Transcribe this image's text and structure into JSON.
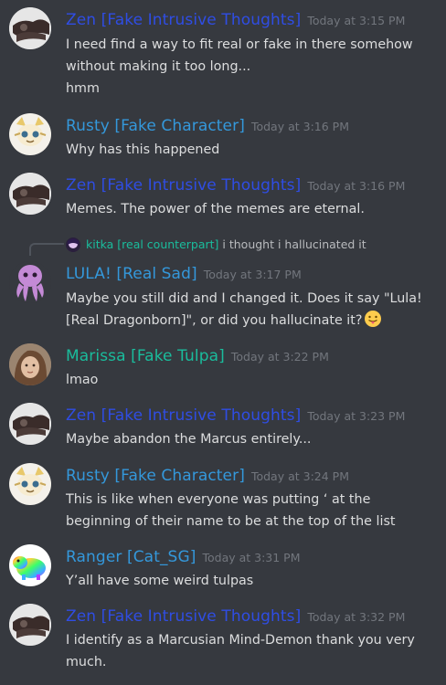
{
  "colors": {
    "zen": "#2f4de4",
    "rusty": "#3498db",
    "lula": "#3498db",
    "marissa": "#1abc9c",
    "ranger": "#3498db",
    "kitka": "#1abc9c",
    "background": "#36393f",
    "timestamp": "#72767d",
    "text": "#dcddde"
  },
  "messages": [
    {
      "author": "Zen [Fake Intrusive Thoughts]",
      "avatar_icon": "zen-avatar",
      "timestamp": "Today at 3:15 PM",
      "lines": [
        "I need find a way to fit real or fake in there somehow without making it too long...",
        "hmm"
      ]
    },
    {
      "author": "Rusty [Fake Character]",
      "avatar_icon": "rusty-avatar",
      "timestamp": "Today at 3:16 PM",
      "lines": [
        "Why has this happened"
      ]
    },
    {
      "author": "Zen [Fake Intrusive Thoughts]",
      "avatar_icon": "zen-avatar",
      "timestamp": "Today at 3:16 PM",
      "lines": [
        "Memes. The power of the memes are eternal."
      ]
    },
    {
      "author": "LULA! [Real Sad]",
      "avatar_icon": "octopus-avatar",
      "timestamp": "Today at 3:17 PM",
      "reply": {
        "author": "kitka [real counterpart]",
        "text": "i thought i hallucinated it"
      },
      "lines": [
        "Maybe you still did and I changed it. Does it say \"Lula! [Real Dragonborn]\", or did you hallucinate it?"
      ],
      "emoji": "tongue-out-emoji"
    },
    {
      "author": "Marissa [Fake Tulpa]",
      "avatar_icon": "marissa-avatar",
      "timestamp": "Today at 3:22 PM",
      "lines": [
        "lmao"
      ]
    },
    {
      "author": "Zen [Fake Intrusive Thoughts]",
      "avatar_icon": "zen-avatar",
      "timestamp": "Today at 3:23 PM",
      "lines": [
        "Maybe abandon the Marcus entirely..."
      ]
    },
    {
      "author": "Rusty [Fake Character]",
      "avatar_icon": "rusty-avatar",
      "timestamp": "Today at 3:24 PM",
      "lines": [
        "This is like when everyone was putting ‘ at the beginning of their name to be at the top of the list"
      ]
    },
    {
      "author": "Ranger [Cat_SG]",
      "avatar_icon": "rainbow-hippo-avatar",
      "timestamp": "Today at 3:31 PM",
      "lines": [
        "Y’all have some weird tulpas"
      ]
    },
    {
      "author": "Zen [Fake Intrusive Thoughts]",
      "avatar_icon": "zen-avatar",
      "timestamp": "Today at 3:32 PM",
      "lines": [
        "I identify as a Marcusian Mind-Demon thank you very much."
      ]
    }
  ]
}
